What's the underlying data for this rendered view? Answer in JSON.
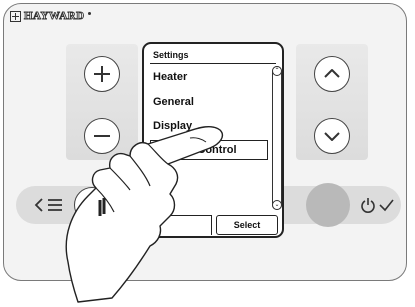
{
  "brand": {
    "name": "HAYWARD"
  },
  "screen": {
    "title": "Settings",
    "menu_items": [
      "Heater",
      "General",
      "Display",
      "Remote Control"
    ],
    "selected_item": "Remote Control",
    "select_label": "Select"
  },
  "controls": {
    "plus_icon": "plus-icon",
    "minus_icon": "minus-icon",
    "up_icon": "chevron-up-icon",
    "down_icon": "chevron-down-icon",
    "back_icon": "back-menu-icon",
    "power_icon": "power-check-icon"
  },
  "colors": {
    "panel": "#f3f3f3",
    "strip": "#dcdcdc",
    "screen_border": "#222222",
    "grey_button": "#b9b9b9"
  }
}
